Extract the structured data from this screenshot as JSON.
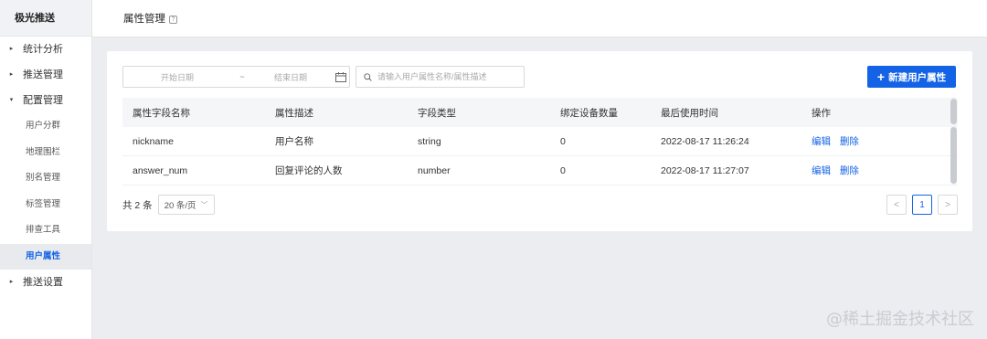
{
  "sidebar": {
    "brand": "极光推送",
    "menu": [
      {
        "label": "统计分析",
        "caret": "▸"
      },
      {
        "label": "推送管理",
        "caret": "▸"
      },
      {
        "label": "配置管理",
        "caret": "▾"
      }
    ],
    "sub_items": [
      "用户分群",
      "地理围栏",
      "别名管理",
      "标签管理",
      "排查工具",
      "用户属性"
    ],
    "last_menu": {
      "label": "推送设置",
      "caret": "▸"
    }
  },
  "header": {
    "title": "属性管理",
    "help": "?"
  },
  "toolbar": {
    "start_date": "开始日期",
    "separator": "~",
    "end_date": "结束日期",
    "search_placeholder": "请输入用户属性名称/属性描述",
    "new_button": "新建用户属性",
    "new_button_icon": "+"
  },
  "table": {
    "columns": [
      "属性字段名称",
      "属性描述",
      "字段类型",
      "绑定设备数量",
      "最后使用时间",
      "操作"
    ],
    "rows": [
      {
        "name": "nickname",
        "desc": "用户名称",
        "type": "string",
        "devices": "0",
        "last_used": "2022-08-17 11:26:24",
        "edit": "编辑",
        "delete": "删除"
      },
      {
        "name": "answer_num",
        "desc": "回复评论的人数",
        "type": "number",
        "devices": "0",
        "last_used": "2022-08-17 11:27:07",
        "edit": "编辑",
        "delete": "删除"
      }
    ]
  },
  "footer": {
    "total": "共 2 条",
    "page_size": "20 条/页",
    "page_size_chevron": "﹀",
    "prev": "<",
    "current_page": "1",
    "next": ">"
  },
  "watermark": "@稀土掘金技术社区",
  "colors": {
    "accent": "#1463e6"
  }
}
